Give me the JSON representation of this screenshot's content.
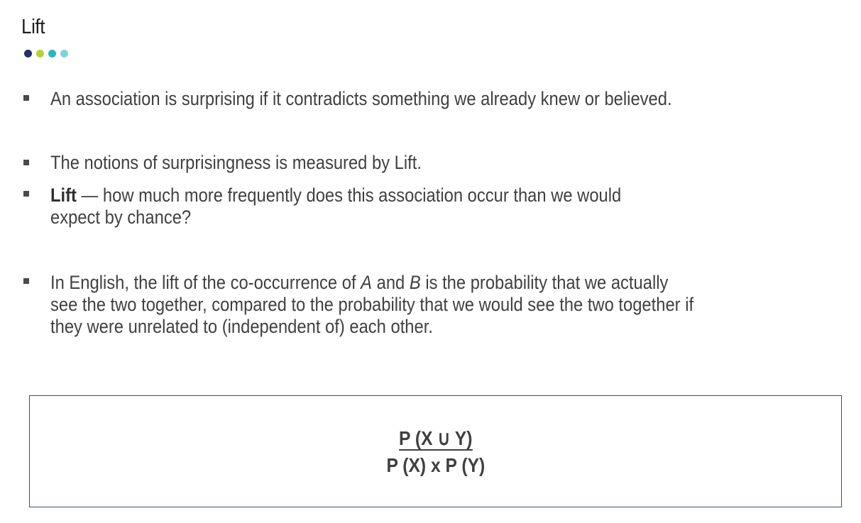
{
  "slide": {
    "title": "Lift",
    "dot_colors": [
      "#23306b",
      "#b5d335",
      "#2cb5c0",
      "#7fd3dc"
    ]
  },
  "bullets": [
    {
      "lines": [
        "An association is surprising if it contradicts something we already knew or believed."
      ]
    },
    {
      "lines": [
        "The notions of surprisingness is measured by Lift."
      ]
    },
    {
      "bold_lead": "Lift",
      "lead_rest": " — how much more frequently does this association occur than we would",
      "line2": "expect by chance?"
    },
    {
      "line1_a": "In English, the lift of the co-occurrence of ",
      "var_a": "A",
      "line1_and": " and ",
      "var_b": "B",
      "line1_b": " is the probability that we actually",
      "line2": "see the two together, compared to the probability that we would see the two together if",
      "line3": "they were unrelated to (independent of) each other."
    }
  ],
  "formula": {
    "numerator": "P (X ∪ Y)",
    "denominator": "P (X) x P (Y)"
  }
}
